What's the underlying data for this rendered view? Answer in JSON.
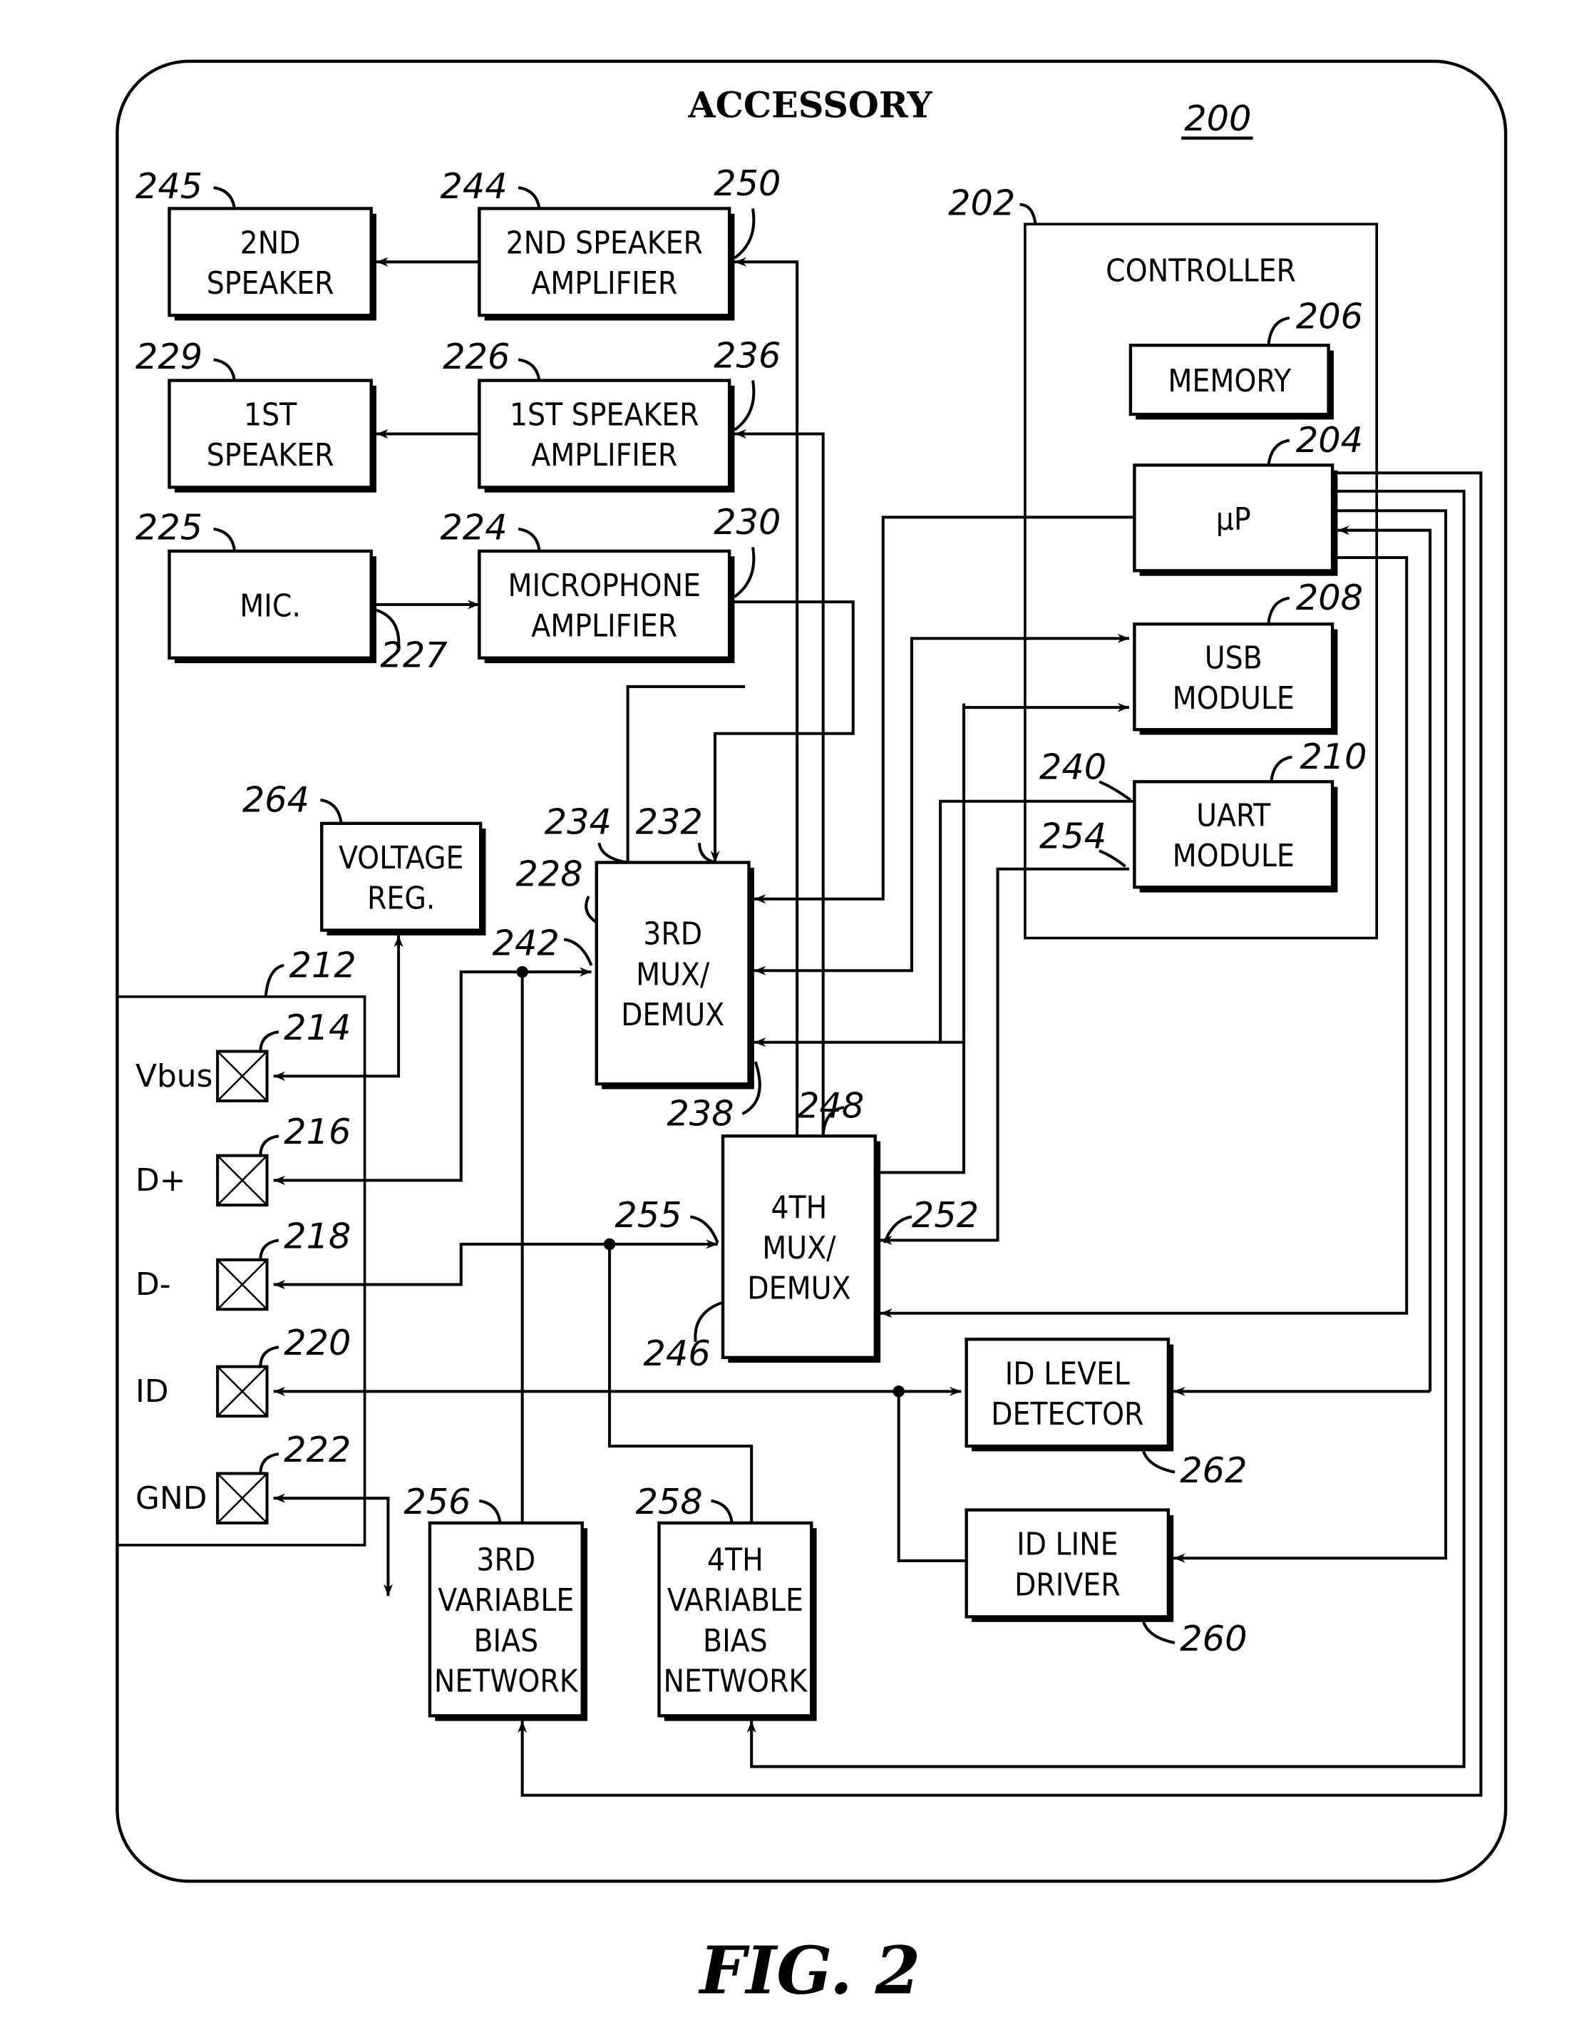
{
  "figure": {
    "title": "ACCESSORY",
    "ref_number": "200",
    "caption": "FIG. 2"
  },
  "blocks": {
    "speaker2": {
      "lines": [
        "2ND",
        "SPEAKER"
      ],
      "ref": "245"
    },
    "speaker2_amp": {
      "lines": [
        "2ND SPEAKER",
        "AMPLIFIER"
      ],
      "ref": "244",
      "input_ref": "250"
    },
    "speaker1": {
      "lines": [
        "1ST",
        "SPEAKER"
      ],
      "ref": "229"
    },
    "speaker1_amp": {
      "lines": [
        "1ST SPEAKER",
        "AMPLIFIER"
      ],
      "ref": "226",
      "input_ref": "236"
    },
    "mic": {
      "lines": [
        "MIC."
      ],
      "ref": "225",
      "output_ref": "227"
    },
    "mic_amp": {
      "lines": [
        "MICROPHONE",
        "AMPLIFIER"
      ],
      "ref": "224",
      "output_ref": "230"
    },
    "controller": {
      "label": "CONTROLLER",
      "ref": "202"
    },
    "memory": {
      "lines": [
        "MEMORY"
      ],
      "ref": "206"
    },
    "up": {
      "lines": [
        "µP"
      ],
      "ref": "204"
    },
    "usb": {
      "lines": [
        "USB",
        "MODULE"
      ],
      "ref": "208"
    },
    "uart": {
      "lines": [
        "UART",
        "MODULE"
      ],
      "ref": "210",
      "in_ref_a": "240",
      "in_ref_b": "254"
    },
    "voltage_reg": {
      "lines": [
        "VOLTAGE",
        "REG."
      ],
      "ref": "264"
    },
    "mux3": {
      "lines": [
        "3RD",
        "MUX/",
        "DEMUX"
      ],
      "ref": "228",
      "top_ref_a": "234",
      "top_ref_b": "232",
      "left_ref": "242",
      "right_ref": "238"
    },
    "mux4": {
      "lines": [
        "4TH",
        "MUX/",
        "DEMUX"
      ],
      "ref": "246",
      "top_ref": "248",
      "left_ref": "255",
      "right_ref": "252"
    },
    "id_level": {
      "lines": [
        "ID LEVEL",
        "DETECTOR"
      ],
      "ref": "262"
    },
    "id_driver": {
      "lines": [
        "ID LINE",
        "DRIVER"
      ],
      "ref": "260"
    },
    "bias3": {
      "lines": [
        "3RD",
        "VARIABLE",
        "BIAS",
        "NETWORK"
      ],
      "ref": "256"
    },
    "bias4": {
      "lines": [
        "4TH",
        "VARIABLE",
        "BIAS",
        "NETWORK"
      ],
      "ref": "258"
    }
  },
  "connector": {
    "ref": "212",
    "pins": [
      {
        "label": "Vbus",
        "ref": "214"
      },
      {
        "label": "D+",
        "ref": "216"
      },
      {
        "label": "D-",
        "ref": "218"
      },
      {
        "label": "ID",
        "ref": "220"
      },
      {
        "label": "GND",
        "ref": "222"
      }
    ]
  }
}
